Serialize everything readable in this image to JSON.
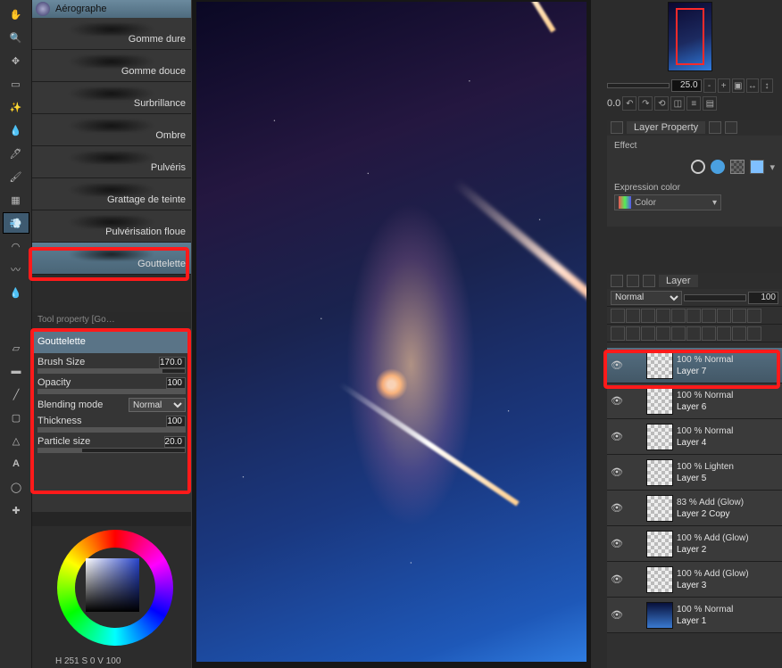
{
  "brush": {
    "category": "Aérographe",
    "items": [
      {
        "label": "Gomme dure"
      },
      {
        "label": "Gomme douce"
      },
      {
        "label": "Surbrillance"
      },
      {
        "label": "Ombre"
      },
      {
        "label": "Pulvéris"
      },
      {
        "label": "Grattage de teinte"
      },
      {
        "label": "Pulvérisation floue"
      },
      {
        "label": "Gouttelette"
      }
    ],
    "selected": "Gouttelette"
  },
  "toolProperty": {
    "panelTitle": "Tool property [Go…",
    "brushLabel": "Gouttelette",
    "rows": {
      "brushSize": {
        "label": "Brush Size",
        "value": "170.0"
      },
      "opacity": {
        "label": "Opacity",
        "value": "100"
      },
      "blending": {
        "label": "Blending mode",
        "value": "Normal"
      },
      "thickness": {
        "label": "Thickness",
        "value": "100"
      },
      "particle": {
        "label": "Particle size",
        "value": "20.0"
      }
    }
  },
  "color": {
    "readout": "H 251 S    0 V 100"
  },
  "navigator": {
    "zoom": "25.0",
    "rotation": "0.0"
  },
  "layerProperty": {
    "title": "Layer Property",
    "effectLabel": "Effect",
    "expressionLabel": "Expression color",
    "expressionValue": "Color"
  },
  "layers": {
    "title": "Layer",
    "blend": "Normal",
    "opacity": "100",
    "items": [
      {
        "mode": "100 % Normal",
        "name": "Layer 7",
        "sel": true
      },
      {
        "mode": "100 % Normal",
        "name": "Layer 6"
      },
      {
        "mode": "100 % Normal",
        "name": "Layer 4"
      },
      {
        "mode": "100 % Lighten",
        "name": "Layer 5"
      },
      {
        "mode": "83 % Add (Glow)",
        "name": "Layer 2 Copy"
      },
      {
        "mode": "100 % Add (Glow)",
        "name": "Layer 2"
      },
      {
        "mode": "100 % Add (Glow)",
        "name": "Layer 3"
      },
      {
        "mode": "100 % Normal",
        "name": "Layer 1",
        "grad": true
      }
    ]
  }
}
